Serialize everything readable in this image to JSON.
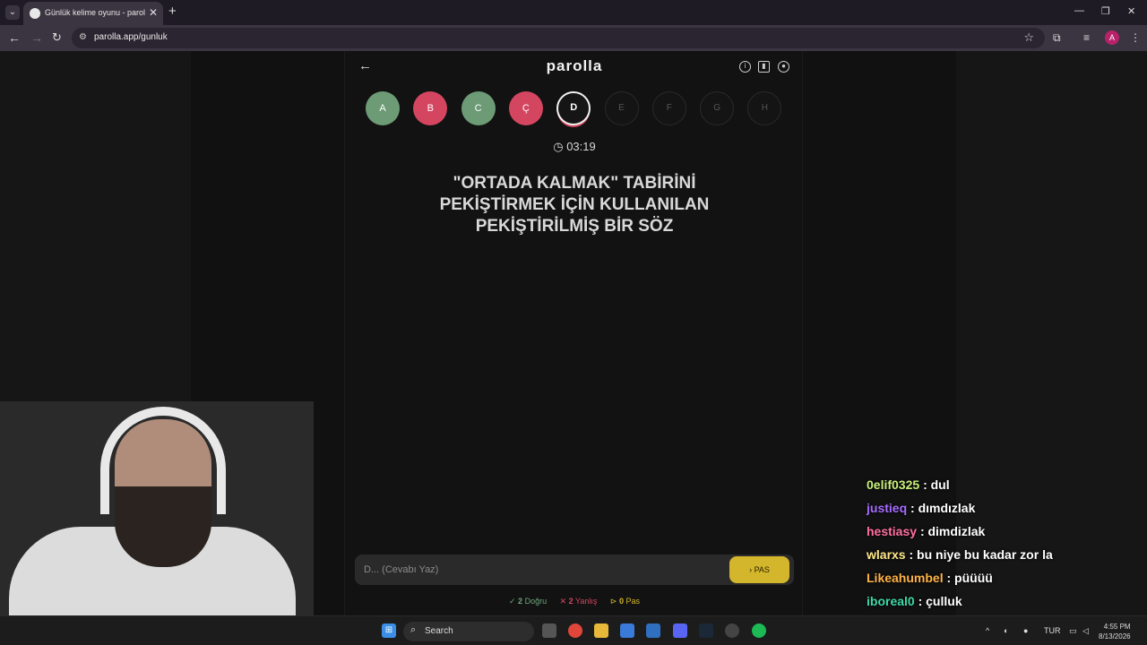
{
  "browser": {
    "tab_title": "Günlük kelime oyunu - parolla",
    "tab_close": "✕",
    "new_tab": "+",
    "url": "parolla.app/gunluk",
    "profile_initial": "A"
  },
  "header": {
    "logo": "parolla",
    "back_icon": "arrow-left-icon",
    "info_icon": "info-icon",
    "stats_icon": "bar-chart-icon",
    "profile_icon": "user-circle-icon"
  },
  "letters": [
    {
      "letter": "A",
      "state": "correct"
    },
    {
      "letter": "B",
      "state": "wrong"
    },
    {
      "letter": "C",
      "state": "correct"
    },
    {
      "letter": "Ç",
      "state": "wrong"
    },
    {
      "letter": "D",
      "state": "current"
    },
    {
      "letter": "E",
      "state": "pending"
    },
    {
      "letter": "F",
      "state": "pending"
    },
    {
      "letter": "G",
      "state": "pending"
    },
    {
      "letter": "H",
      "state": "pending"
    }
  ],
  "timer": "03:19",
  "question": "\"ORTADA KALMAK\" TABİRİNİ PEKİŞTİRMEK İÇİN KULLANILAN PEKİŞTİRİLMİŞ BİR SÖZ",
  "answer": {
    "placeholder": "D... (Cevabı Yaz)",
    "value": "",
    "pass_label": "PAS"
  },
  "stats": {
    "correct_count": "2",
    "correct_label": "Doğru",
    "wrong_count": "2",
    "wrong_label": "Yanlış",
    "pass_count": "0",
    "pass_label": "Pas"
  },
  "chat": [
    {
      "user": "0elif0325",
      "message": ": dul",
      "color": "#c8f07a"
    },
    {
      "user": "justieq",
      "message": ": dımdızlak",
      "color": "#a66bff"
    },
    {
      "user": "hestiasy",
      "message": ": dimdizlak",
      "color": "#ff6fa0"
    },
    {
      "user": "wlarxs",
      "message": ": bu niye bu kadar zor la",
      "color": "#ffe88a"
    },
    {
      "user": "Likeahumbel",
      "message": ": püüüü",
      "color": "#ffb347"
    },
    {
      "user": "iboreal0",
      "message": ": çulluk",
      "color": "#3ed9a8"
    }
  ],
  "taskbar": {
    "search_label": "Search",
    "language": "TUR",
    "time": "4:55 PM",
    "date": "8/13/2026"
  },
  "colors": {
    "correct": "#6d9b76",
    "wrong": "#d44660",
    "pass_button": "#d4b62c"
  }
}
